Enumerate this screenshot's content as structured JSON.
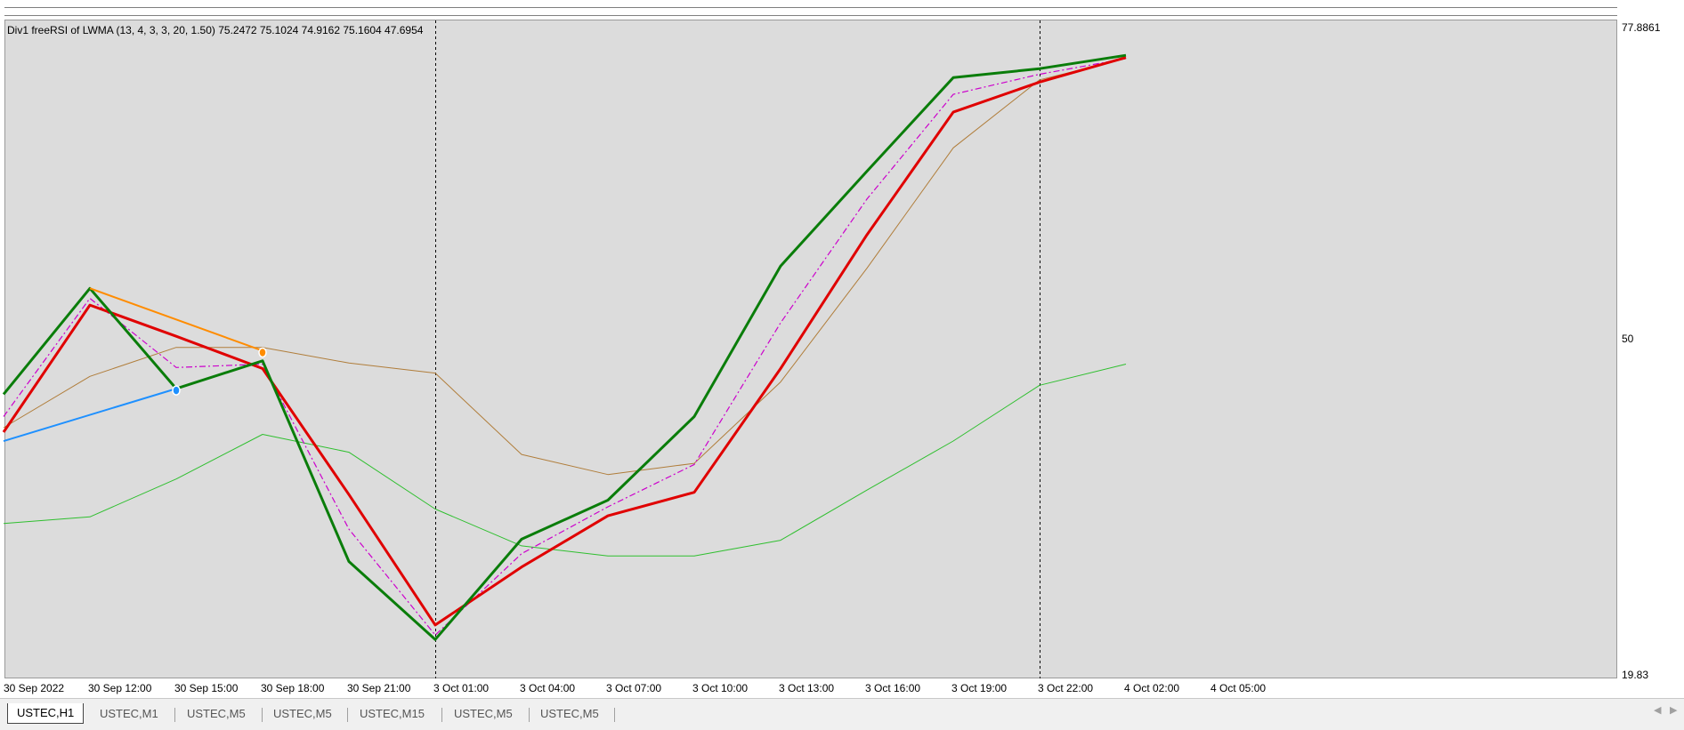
{
  "indicator_label": "Div1 freeRSI of LWMA (13, 4, 3, 3, 20, 1.50) 75.2472 75.1024 74.9162 75.1604 47.6954",
  "price_scale": {
    "top": "77.8861",
    "mid": "50",
    "bottom": "19.83"
  },
  "time_axis": [
    "30 Sep 2022",
    "30 Sep 12:00",
    "30 Sep 15:00",
    "30 Sep 18:00",
    "30 Sep 21:00",
    "3 Oct 01:00",
    "3 Oct 04:00",
    "3 Oct 07:00",
    "3 Oct 10:00",
    "3 Oct 13:00",
    "3 Oct 16:00",
    "3 Oct 19:00",
    "3 Oct 22:00",
    "4 Oct 02:00",
    "4 Oct 05:00"
  ],
  "tabs": [
    {
      "label": "USTEC,H1",
      "active": true
    },
    {
      "label": "USTEC,M1",
      "active": false
    },
    {
      "label": "USTEC,M5",
      "active": false
    },
    {
      "label": "USTEC,M5",
      "active": false
    },
    {
      "label": "USTEC,M15",
      "active": false
    },
    {
      "label": "USTEC,M5",
      "active": false
    },
    {
      "label": "USTEC,M5",
      "active": false
    }
  ],
  "chart_data": {
    "type": "line",
    "x": [
      "30 Sep 2022",
      "30 Sep 12:00",
      "30 Sep 15:00",
      "30 Sep 18:00",
      "30 Sep 21:00",
      "3 Oct 01:00",
      "3 Oct 04:00",
      "3 Oct 07:00",
      "3 Oct 10:00",
      "3 Oct 13:00",
      "3 Oct 16:00",
      "3 Oct 19:00",
      "3 Oct 22:00",
      "4 Oct 02:00",
      "4 Oct 05:00"
    ],
    "ylim": [
      19.83,
      77.8861
    ],
    "series": [
      {
        "values": [
          45,
          54.5,
          45.5,
          48,
          30,
          23,
          32,
          35.5,
          43,
          56.5,
          65,
          73.4,
          74.2,
          75.4
        ],
        "color": "#0a7d0a"
      },
      {
        "values": [
          41.6,
          53,
          50.2,
          47.3,
          36,
          24.3,
          29.5,
          34.1,
          36.2,
          47.3,
          59.3,
          70.3,
          73,
          75.2
        ],
        "color": "#e00000"
      },
      {
        "values": [
          43,
          53.6,
          47.4,
          47.7,
          32.9,
          23.4,
          30.7,
          34.9,
          38.7,
          51.4,
          62.5,
          71.9,
          73.7,
          75.1
        ],
        "color": "#cc00cc"
      },
      {
        "values": [
          42,
          46.6,
          49.2,
          49.2,
          47.8,
          46.9,
          39.6,
          37.8,
          38.8,
          46.1,
          56.3,
          67.1,
          73.2,
          75.1
        ],
        "color": "#b07d3a"
      },
      {
        "values": [
          33.4,
          34,
          37.4,
          41.4,
          39.8,
          34.7,
          31.4,
          30.5,
          30.5,
          31.9,
          36.4,
          40.8,
          45.8,
          47.7
        ],
        "color": "#2fbf2f"
      }
    ],
    "divergence_lines": [
      {
        "color": "#ff8c00",
        "from": [
          "30 Sep 12:00",
          54.5
        ],
        "to": [
          "30 Sep 18:00",
          48.9
        ]
      },
      {
        "color": "#1e90ff",
        "from": [
          "30 Sep 2022",
          40.8
        ],
        "to": [
          "30 Sep 15:00",
          45.5
        ]
      }
    ],
    "vlines": [
      "3 Oct 01:00",
      "3 Oct 22:00"
    ]
  }
}
